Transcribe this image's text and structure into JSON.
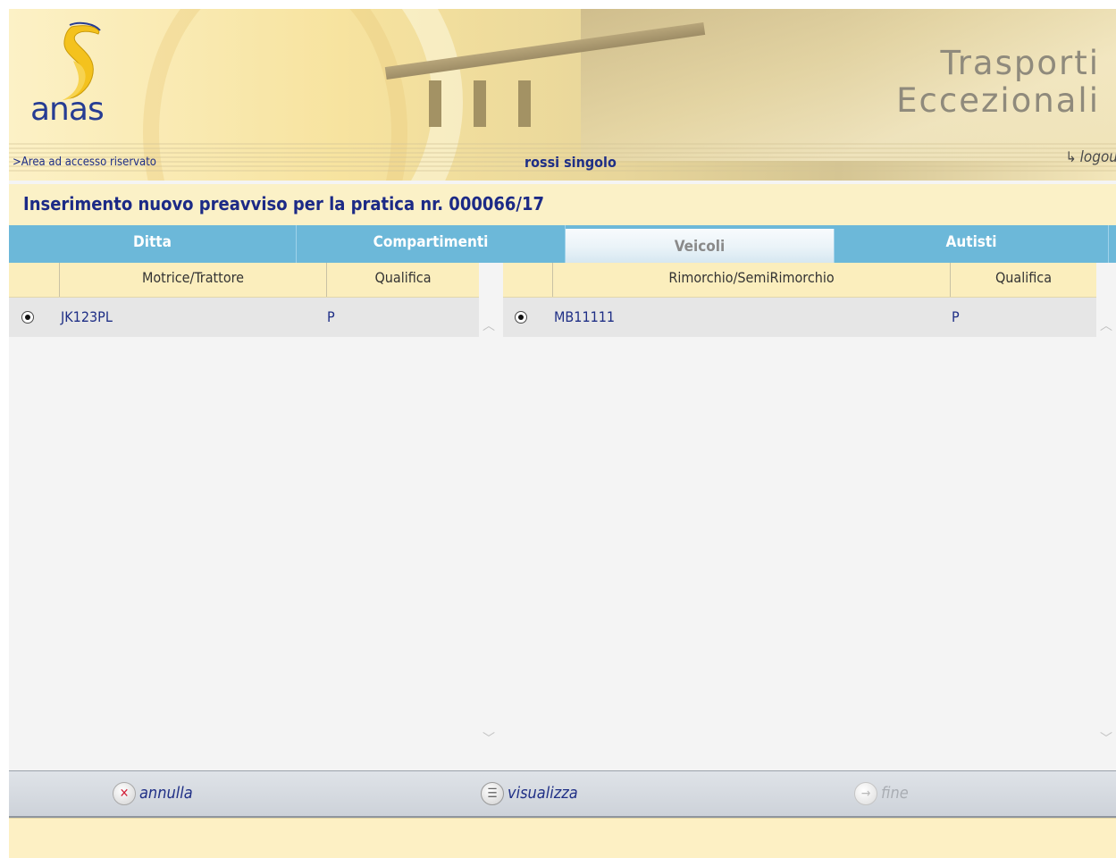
{
  "header": {
    "logo_text": "anas",
    "app_title_line1": "Trasporti",
    "app_title_line2": "Eccezionali",
    "area_link": ">Area ad accesso riservato",
    "user_name": "rossi singolo",
    "logout_label": "logout"
  },
  "page_title": "Inserimento nuovo preavviso per la pratica nr. 000066/17",
  "tabs": [
    {
      "label": "Ditta",
      "active": false
    },
    {
      "label": "Compartimenti",
      "active": false
    },
    {
      "label": "Veicoli",
      "active": true
    },
    {
      "label": "Autisti",
      "active": false
    }
  ],
  "left_grid": {
    "columns": [
      "Motrice/Trattore",
      "Qualifica"
    ],
    "rows": [
      {
        "selected": true,
        "plate": "JK123PL",
        "qualifica": "P"
      }
    ]
  },
  "right_grid": {
    "columns": [
      "Rimorchio/SemiRimorchio",
      "Qualifica"
    ],
    "rows": [
      {
        "selected": true,
        "plate": "MB11111",
        "qualifica": "P"
      }
    ]
  },
  "toolbar": {
    "annulla_label": "annulla",
    "visualizza_label": "visualizza",
    "fine_label": "fine"
  },
  "icons": {
    "annulla": "close-circle-icon",
    "visualizza": "list-icon",
    "fine": "next-arrow-icon"
  },
  "colors": {
    "tab_bar": "#6cb8d9",
    "title_text": "#1c2a86",
    "header_bg": "#fbf1c7"
  }
}
